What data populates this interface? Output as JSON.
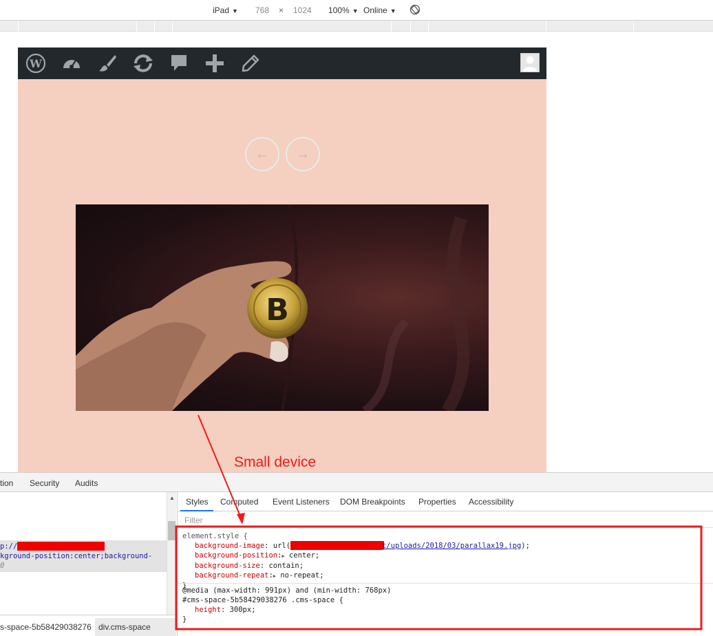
{
  "device_toolbar": {
    "device": "iPad",
    "width": "768",
    "times": "×",
    "height": "1024",
    "zoom": "100%",
    "network": "Online",
    "rotate_icon": "rotate-icon"
  },
  "wp_admin_bar": {
    "icons": [
      "wordpress-logo-icon",
      "dashboard-icon",
      "customize-brush-icon",
      "updates-icon",
      "comments-icon",
      "new-content-plus-icon",
      "edit-pencil-icon"
    ],
    "avatar": "user-avatar"
  },
  "slider": {
    "prev_label": "←",
    "next_label": "→"
  },
  "annotation": {
    "text": "Small device"
  },
  "devtools": {
    "tabs": [
      "tion",
      "Security",
      "Audits"
    ],
    "elements": {
      "line1_prefix": "p://",
      "line1_redacted": "████████████████████",
      "line2": "kground-position:center;background-",
      "line3": "0"
    },
    "breadcrumbs": [
      "s-space-5b58429038276",
      "div.cms-space"
    ],
    "styles_tabs": [
      "Styles",
      "Computed",
      "Event Listeners",
      "DOM Breakpoints",
      "Properties",
      "Accessibility"
    ],
    "active_styles_tab": "Styles",
    "filter_placeholder": "Filter",
    "rules": {
      "element_style_selector": "element.style {",
      "bg_image_prop": "background-image",
      "bg_image_url_prefix": "url(",
      "bg_image_redacted": "████████████████████████████████████████",
      "bg_image_url_suffix": "t/uploads/2018/03/parallax19.jpg",
      "bg_image_end": ");",
      "bg_position_prop": "background-position",
      "bg_position_val": "center;",
      "bg_size_prop": "background-size",
      "bg_size_val": "contain;",
      "bg_repeat_prop": "background-repeat",
      "bg_repeat_val": "no-repeat;",
      "close1": "}",
      "media_query": "@media (max-width: 991px) and (min-width: 768px)",
      "media_selector": "#cms-space-5b58429038276 .cms-space {",
      "height_prop": "height",
      "height_val": "300px;",
      "close2": "}"
    }
  },
  "colors": {
    "annotation_red": "#ee1b1b",
    "device_bg": "#f5cfc0",
    "wp_bar": "#23282d"
  }
}
